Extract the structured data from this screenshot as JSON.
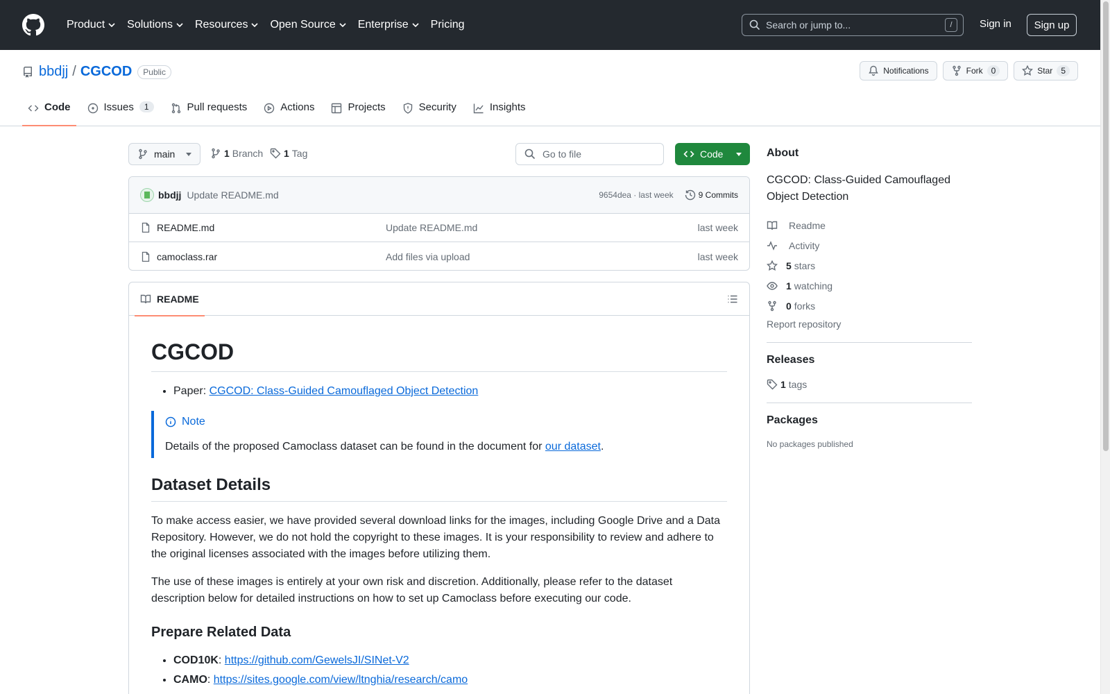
{
  "header": {
    "nav": [
      "Product",
      "Solutions",
      "Resources",
      "Open Source",
      "Enterprise",
      "Pricing"
    ],
    "search_placeholder": "Search or jump to...",
    "search_shortcut": "/",
    "sign_in": "Sign in",
    "sign_up": "Sign up"
  },
  "repo": {
    "owner": "bbdjj",
    "separator": "/",
    "name": "CGCOD",
    "visibility": "Public",
    "notifications_label": "Notifications",
    "fork_label": "Fork",
    "fork_count": "0",
    "star_label": "Star",
    "star_count": "5"
  },
  "tabs": [
    {
      "label": "Code",
      "active": true
    },
    {
      "label": "Issues",
      "count": "1"
    },
    {
      "label": "Pull requests"
    },
    {
      "label": "Actions"
    },
    {
      "label": "Projects"
    },
    {
      "label": "Security"
    },
    {
      "label": "Insights"
    }
  ],
  "browser": {
    "branch": "main",
    "branch_count": "1",
    "branch_label": "Branch",
    "tag_count": "1",
    "tag_label": "Tag",
    "goto_placeholder": "Go to file",
    "code_button": "Code"
  },
  "latest_commit": {
    "user": "bbdjj",
    "message": "Update README.md",
    "meta": "9654dea · last week",
    "commits": "9 Commits"
  },
  "files": [
    {
      "name": "README.md",
      "message": "Update README.md",
      "time": "last week"
    },
    {
      "name": "camoclass.rar",
      "message": "Add files via upload",
      "time": "last week"
    }
  ],
  "readme": {
    "tab_label": "README",
    "title": "CGCOD",
    "paper_prefix": "Paper: ",
    "paper_link": "CGCOD: Class-Guided Camouflaged Object Detection",
    "note_title": "Note",
    "note_text": "Details of the proposed Camoclass dataset can be found in the document for ",
    "note_link": "our dataset",
    "note_end": ".",
    "h2": "Dataset Details",
    "p1": "To make access easier, we have provided several download links for the images, including Google Drive and a Data Repository. However, we do not hold the copyright to these images. It is your responsibility to review and adhere to the original licenses associated with the images before utilizing them.",
    "p2": "The use of these images is entirely at your own risk and discretion. Additionally, please refer to the dataset description below for detailed instructions on how to set up Camoclass before executing our code.",
    "h3": "Prepare Related Data",
    "data_items": [
      {
        "name": "COD10K",
        "sep": ": ",
        "link": "https://github.com/GewelsJI/SINet-V2"
      },
      {
        "name": "CAMO",
        "sep": ": ",
        "link": "https://sites.google.com/view/ltnghia/research/camo"
      }
    ]
  },
  "about": {
    "title": "About",
    "description": "CGCOD: Class-Guided Camouflaged Object Detection",
    "items": [
      {
        "icon": "book-icon",
        "count": "",
        "label": "Readme"
      },
      {
        "icon": "pulse-icon",
        "count": "",
        "label": "Activity"
      },
      {
        "icon": "star-icon",
        "count": "5",
        "label": "stars"
      },
      {
        "icon": "eye-icon",
        "count": "1",
        "label": "watching"
      },
      {
        "icon": "fork-icon",
        "count": "0",
        "label": "forks"
      }
    ],
    "report": "Report repository"
  },
  "releases": {
    "title": "Releases",
    "count": "1",
    "label": "tags"
  },
  "packages": {
    "title": "Packages",
    "empty": "No packages published"
  },
  "colors": {
    "header_bg": "#24292f",
    "link": "#0969da",
    "primary_button": "#1f883d",
    "active_tab": "#fd8c73"
  }
}
